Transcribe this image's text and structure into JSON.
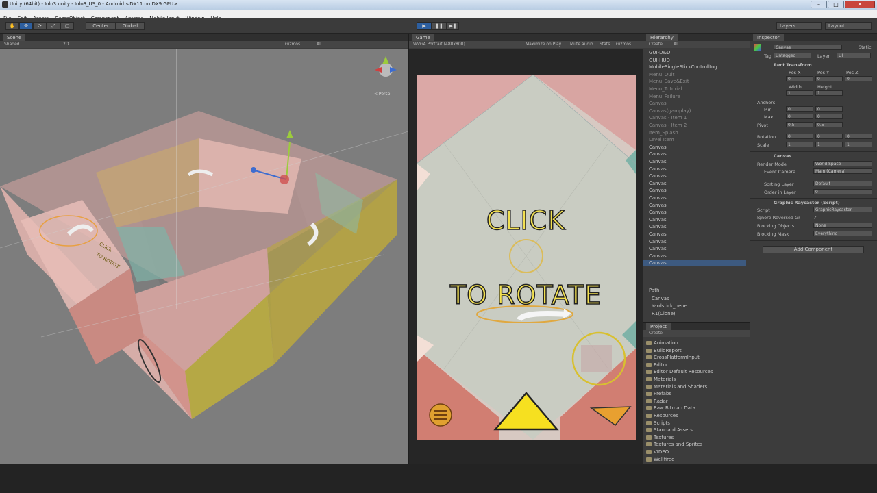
{
  "window": {
    "title": "Unity (64bit) - Iolo3.unity - Iolo3_US_0 - Android <DX11 on DX9 GPU>",
    "minimize": "–",
    "maximize": "□",
    "close": "✕"
  },
  "menu": [
    "File",
    "Edit",
    "Assets",
    "GameObject",
    "Component",
    "Antares",
    "Mobile Input",
    "Window",
    "Help"
  ],
  "toolbar": {
    "pivot": "Center",
    "space": "Global",
    "layers": "Layers",
    "layout": "Layout"
  },
  "scene": {
    "tab": "Scene",
    "shading": "Shaded",
    "mode2d": "2D",
    "gizmos": "Gizmos",
    "search": "All",
    "persp": "< Persp",
    "overlay_click": "CLICK",
    "overlay_rotate": "TO ROTATE"
  },
  "game": {
    "tab": "Game",
    "aspect": "WVGA Portrait (480x800)",
    "maximize": "Maximize on Play",
    "mute": "Mute audio",
    "stats": "Stats",
    "gizmos": "Gizmos",
    "click": "CLICK",
    "rotate": "TO ROTATE"
  },
  "hierarchy": {
    "tab": "Hierarchy",
    "create": "Create",
    "search": "All",
    "items": [
      {
        "label": "GUI-D&D",
        "dim": false
      },
      {
        "label": "GUI-HUD",
        "dim": false
      },
      {
        "label": "MobileSingleStickControllIng",
        "dim": false
      },
      {
        "label": "Menu_Quit",
        "dim": true
      },
      {
        "label": "Menu_Save&Exit",
        "dim": true
      },
      {
        "label": "Menu_Tutorial",
        "dim": true
      },
      {
        "label": "Menu_Failure",
        "dim": true
      },
      {
        "label": "Canvas",
        "dim": true
      },
      {
        "label": "Canvas(gamplay)",
        "dim": true
      },
      {
        "label": "Canvas - Item 1",
        "dim": true
      },
      {
        "label": "Canvas - Item 2",
        "dim": true
      },
      {
        "label": "Item_Splash",
        "dim": true
      },
      {
        "label": "Level Item",
        "dim": true
      },
      {
        "label": "Canvas",
        "dim": false
      },
      {
        "label": "Canvas",
        "dim": false
      },
      {
        "label": "Canvas",
        "dim": false
      },
      {
        "label": "Canvas",
        "dim": false
      },
      {
        "label": "Canvas",
        "dim": false
      },
      {
        "label": "Canvas",
        "dim": false
      },
      {
        "label": "Canvas",
        "dim": false
      },
      {
        "label": "Canvas",
        "dim": false
      },
      {
        "label": "Canvas",
        "dim": false
      },
      {
        "label": "Canvas",
        "dim": false
      },
      {
        "label": "Canvas",
        "dim": false
      },
      {
        "label": "Canvas",
        "dim": false
      },
      {
        "label": "Canvas",
        "dim": false
      },
      {
        "label": "Canvas",
        "dim": false
      },
      {
        "label": "Canvas",
        "dim": false
      },
      {
        "label": "Canvas",
        "dim": false
      },
      {
        "label": "Canvas",
        "dim": false
      }
    ],
    "path_label": "Path:",
    "path": [
      "Canvas",
      "Yardstick_neue",
      "R1(Clone)"
    ]
  },
  "project": {
    "tab": "Project",
    "create": "Create",
    "folders": [
      "Animation",
      "BuildReport",
      "CrossPlatformInput",
      "Editor",
      "Editor Default Resources",
      "Materials",
      "Materials and Shaders",
      "Prefabs",
      "Radar",
      "Raw Bitmap Data",
      "Resources",
      "Scripts",
      "Standard Assets",
      "Textures",
      "Textures and Sprites",
      "VIDEO",
      "Wellfired"
    ]
  },
  "inspector": {
    "tab": "Inspector",
    "object_name": "Canvas",
    "static": "Static",
    "tag_label": "Tag",
    "tag": "Untagged",
    "layer_label": "Layer",
    "layer": "UI",
    "rect_transform": "Rect Transform",
    "pos_x_label": "Pos X",
    "pos_y_label": "Pos Y",
    "pos_z_label": "Pos Z",
    "pos_x": "0",
    "pos_y": "0",
    "pos_z": "0",
    "width_label": "Width",
    "height_label": "Height",
    "width": "1",
    "height": "1",
    "anchors": "Anchors",
    "min_label": "Min",
    "max_label": "Max",
    "pivot_label": "Pivot",
    "min_x": "0",
    "min_y": "0",
    "max_x": "0",
    "max_y": "0",
    "pivot_x": "0.5",
    "pivot_y": "0.5",
    "rotation_label": "Rotation",
    "scale_label": "Scale",
    "rot_x": "0",
    "rot_y": "0",
    "rot_z": "0",
    "scale_x": "1",
    "scale_y": "1",
    "scale_z": "1",
    "canvas": "Canvas",
    "render_mode_label": "Render Mode",
    "render_mode": "World Space",
    "event_camera_label": "Event Camera",
    "event_camera": "Main (Camera)",
    "sorting_layer_label": "Sorting Layer",
    "sorting_layer": "Default",
    "order_label": "Order in Layer",
    "order": "0",
    "raycaster": "Graphic Raycaster (Script)",
    "script_label": "Script",
    "script": "GraphicRaycaster",
    "ignore_label": "Ignore Reversed Gr",
    "ignore": "✓",
    "blocking_objects_label": "Blocking Objects",
    "blocking_objects": "None",
    "blocking_mask_label": "Blocking Mask",
    "blocking_mask": "Everything",
    "add_component": "Add Component"
  }
}
